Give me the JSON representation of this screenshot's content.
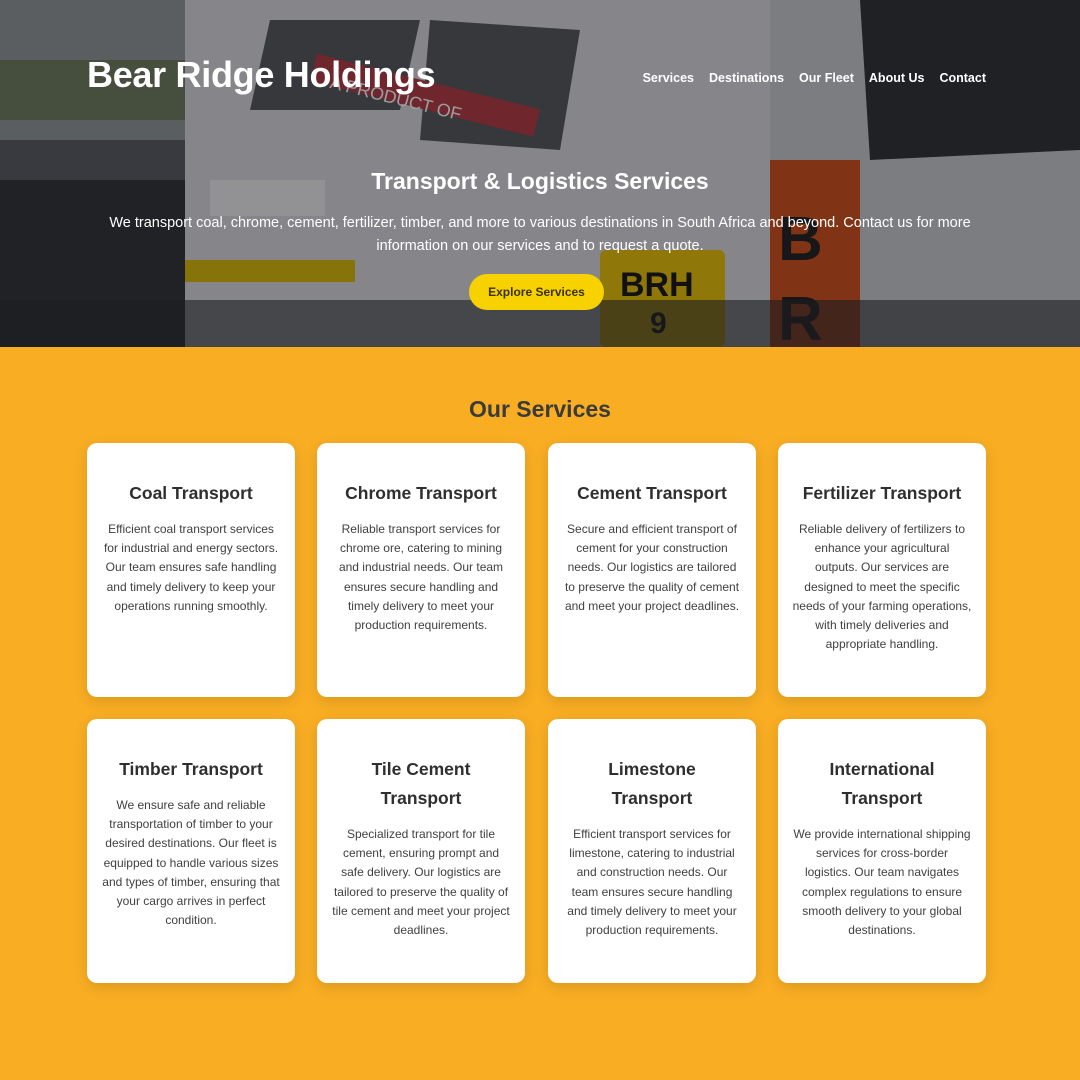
{
  "header": {
    "site_title": "Bear Ridge Holdings",
    "nav": [
      "Services",
      "Destinations",
      "Our Fleet",
      "About Us",
      "Contact"
    ]
  },
  "hero": {
    "truck_lettering": "A PRODUCT OF",
    "plate_top": "BRH",
    "plate_bottom": "9",
    "heading": "Transport & Logistics Services",
    "text": "We transport coal, chrome, cement, fertilizer, timber, and more to various destinations in South Africa and beyond. Contact us for more information on our services and to request a quote.",
    "cta_label": "Explore Services",
    "cta_color": "#f7d200"
  },
  "services": {
    "title": "Our Services",
    "cards": [
      {
        "title": "Coal Transport",
        "text": "Efficient coal transport services for industrial and energy sectors. Our team ensures safe handling and timely delivery to keep your operations running smoothly."
      },
      {
        "title": "Chrome Transport",
        "text": "Reliable transport services for chrome ore, catering to mining and industrial needs. Our team ensures secure handling and timely delivery to meet your production requirements."
      },
      {
        "title": "Cement Transport",
        "text": "Secure and efficient transport of cement for your construction needs. Our logistics are tailored to preserve the quality of cement and meet your project deadlines."
      },
      {
        "title": "Fertilizer Transport",
        "text": "Reliable delivery of fertilizers to enhance your agricultural outputs. Our services are designed to meet the specific needs of your farming operations, with timely deliveries and appropriate handling."
      },
      {
        "title": "Timber Transport",
        "text": "We ensure safe and reliable transportation of timber to your desired destinations. Our fleet is equipped to handle various sizes and types of timber, ensuring that your cargo arrives in perfect condition."
      },
      {
        "title": "Tile Cement Transport",
        "text": "Specialized transport for tile cement, ensuring prompt and safe delivery. Our logistics are tailored to preserve the quality of tile cement and meet your project deadlines."
      },
      {
        "title": "Limestone Transport",
        "text": "Efficient transport services for limestone, catering to industrial and construction needs. Our team ensures secure handling and timely delivery to meet your production requirements."
      },
      {
        "title": "International Transport",
        "text": "We provide international shipping services for cross-border logistics. Our team navigates complex regulations to ensure smooth delivery to your global destinations."
      }
    ]
  },
  "colors": {
    "accent": "#f8ad23",
    "card_bg": "#ffffff",
    "heading_text": "#2f2f2f"
  }
}
